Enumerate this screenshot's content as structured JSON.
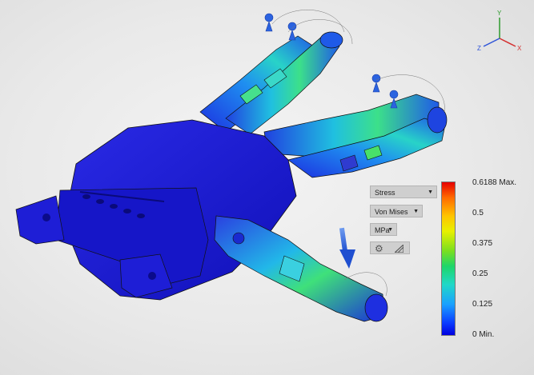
{
  "result_panel": {
    "result_type": "Stress",
    "stress_component": "Von Mises",
    "unit": "MPa",
    "settings_icon": "gear-icon",
    "adjust_icon": "ramp-icon"
  },
  "legend": {
    "ticks": [
      "0.6188 Max.",
      "0.5",
      "0.375",
      "0.25",
      "0.125",
      "0 Min."
    ]
  },
  "view_cube": {
    "x_label": "X",
    "y_label": "Y",
    "z_label": "Z"
  },
  "colors": {
    "model_base": "#1a1ad6",
    "stress_high": "#e60000",
    "stress_low": "#0000e0",
    "load_arrow": "#3a6fd8"
  }
}
